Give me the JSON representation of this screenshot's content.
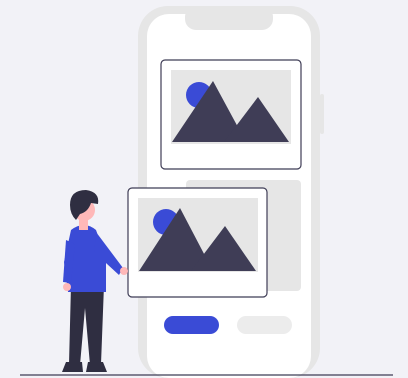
{
  "illustration": {
    "colors": {
      "background": "#f2f2f7",
      "phone_frame": "#e6e6e6",
      "phone_screen": "#ffffff",
      "placeholder_fill": "#e6e6e6",
      "mountain": "#3f3d56",
      "sun": "#3a4bd6",
      "primary_button": "#3a4bd6",
      "secondary_button": "#ececec",
      "card_border": "#3f3d56",
      "skin": "#ffb8b8",
      "hair": "#2f2e41",
      "shirt": "#3a4bd6",
      "pants": "#2f2e41",
      "ground_line": "#3f3d56"
    },
    "icons": [
      "image-placeholder-icon",
      "image-placeholder-icon"
    ]
  }
}
